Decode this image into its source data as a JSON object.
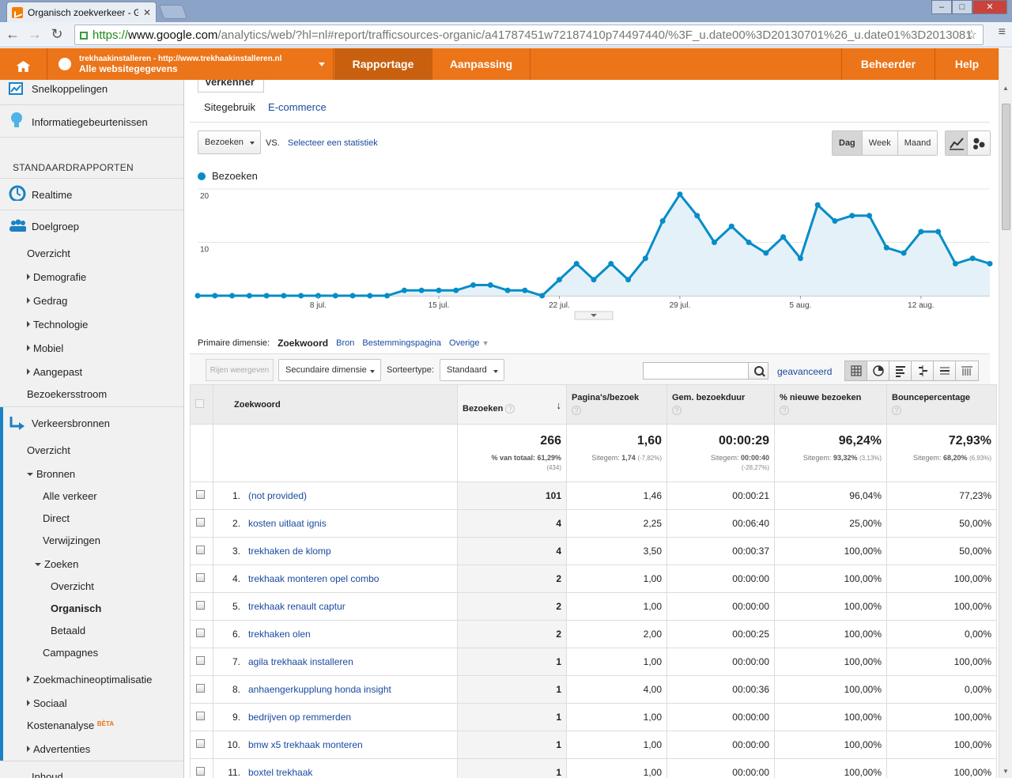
{
  "browser": {
    "tab_title": "Organisch zoekverkeer - G",
    "url_https": "https://",
    "url_host": "www.google.com",
    "url_path": "/analytics/web/?hl=nl#report/trafficsources-organic/a41787451w72187410p74497440/%3F_u.date00%3D20130701%26_u.date01%3D2013081"
  },
  "header": {
    "account_url": "trekhaakinstalleren - http://www.trekhaakinstalleren.nl",
    "account_view": "Alle websitegegevens",
    "tabs": [
      "Rapportage",
      "Aanpassing"
    ],
    "right_tabs": [
      "Beheerder",
      "Help"
    ]
  },
  "sidebar": {
    "snelkoppelingen": "Snelkoppelingen",
    "informatie": "Informatiegebeurtenissen",
    "standaard": "STANDAARDRAPPORTEN",
    "realtime": "Realtime",
    "doelgroep": "Doelgroep",
    "doelgroep_items": [
      "Overzicht",
      "Demografie",
      "Gedrag",
      "Technologie",
      "Mobiel",
      "Aangepast"
    ],
    "bezoekersstroom": "Bezoekersstroom",
    "verkeersbronnen": "Verkeersbronnen",
    "vb_overzicht": "Overzicht",
    "bronnen": "Bronnen",
    "bronnen_items": [
      "Alle verkeer",
      "Direct",
      "Verwijzingen"
    ],
    "zoeken": "Zoeken",
    "zoeken_items": [
      "Overzicht",
      "Organisch",
      "Betaald"
    ],
    "campagnes": "Campagnes",
    "seo": "Zoekmachineoptimalisatie",
    "sociaal": "Sociaal",
    "kosten": "Kostenanalyse",
    "beta": "BÈTA",
    "advertenties": "Advertenties",
    "inhoud": "Inhoud"
  },
  "explorer": {
    "tab": "Verkenner",
    "subtabs": [
      "Sitegebruik",
      "E-commerce"
    ],
    "metric": "Bezoeken",
    "vs": "VS.",
    "select_metric": "Selecteer een statistiek",
    "periods": [
      "Dag",
      "Week",
      "Maand"
    ],
    "active_period": "Dag"
  },
  "chart_data": {
    "type": "area",
    "series": [
      {
        "name": "Bezoeken",
        "values": [
          0,
          0,
          0,
          0,
          0,
          0,
          0,
          0,
          0,
          0,
          0,
          0,
          1,
          1,
          1,
          1,
          2,
          2,
          1,
          1,
          0,
          3,
          6,
          3,
          6,
          3,
          7,
          14,
          19,
          15,
          10,
          13,
          10,
          8,
          11,
          7,
          17,
          14,
          15,
          15,
          9,
          8,
          12,
          12,
          6,
          7,
          6
        ]
      }
    ],
    "x_tick_labels": [
      "8 jul.",
      "15 jul.",
      "22 jul.",
      "29 jul.",
      "5 aug.",
      "12 aug."
    ],
    "y_tick_labels": [
      "10",
      "20"
    ],
    "ylim": [
      0,
      20
    ],
    "color": "#058dc7",
    "fill": "#e5f1f8",
    "legend_position": "top-left",
    "grid": true
  },
  "dimensions": {
    "label": "Primaire dimensie:",
    "current": "Zoekwoord",
    "others": [
      "Bron",
      "Bestemmingspagina",
      "Overige"
    ]
  },
  "table_toolbar": {
    "rows_button": "Rijen weergeven",
    "secondary": "Secundaire dimensie",
    "sort_label": "Sorteertype:",
    "sort_value": "Standaard",
    "advanced": "geavanceerd"
  },
  "table": {
    "headers": [
      "Zoekwoord",
      "Bezoeken",
      "Pagina's/bezoek",
      "Gem. bezoekduur",
      "% nieuwe bezoeken",
      "Bouncepercentage"
    ],
    "totals": {
      "visits": "266",
      "visits_sub1": "% van totaal: 61,29%",
      "visits_sub2": "(434)",
      "pages": "1,60",
      "pages_sub_label": "Sitegem:",
      "pages_sub_val": "1,74",
      "pages_sub_pct": "(-7,82%)",
      "duration": "00:00:29",
      "duration_sub_label": "Sitegem:",
      "duration_sub_val": "00:00:40",
      "duration_sub_pct": "(-28,27%)",
      "new": "96,24%",
      "new_sub_label": "Sitegem:",
      "new_sub_val": "93,32%",
      "new_sub_pct": "(3,13%)",
      "bounce": "72,93%",
      "bounce_sub_label": "Sitegem:",
      "bounce_sub_val": "68,20%",
      "bounce_sub_pct": "(6,93%)"
    },
    "rows": [
      {
        "rank": "1.",
        "kw": "(not provided)",
        "visits": "101",
        "pages": "1,46",
        "dur": "00:00:21",
        "new": "96,04%",
        "bounce": "77,23%"
      },
      {
        "rank": "2.",
        "kw": "kosten uitlaat ignis",
        "visits": "4",
        "pages": "2,25",
        "dur": "00:06:40",
        "new": "25,00%",
        "bounce": "50,00%"
      },
      {
        "rank": "3.",
        "kw": "trekhaken de klomp",
        "visits": "4",
        "pages": "3,50",
        "dur": "00:00:37",
        "new": "100,00%",
        "bounce": "50,00%"
      },
      {
        "rank": "4.",
        "kw": "trekhaak monteren opel combo",
        "visits": "2",
        "pages": "1,00",
        "dur": "00:00:00",
        "new": "100,00%",
        "bounce": "100,00%"
      },
      {
        "rank": "5.",
        "kw": "trekhaak renault captur",
        "visits": "2",
        "pages": "1,00",
        "dur": "00:00:00",
        "new": "100,00%",
        "bounce": "100,00%"
      },
      {
        "rank": "6.",
        "kw": "trekhaken olen",
        "visits": "2",
        "pages": "2,00",
        "dur": "00:00:25",
        "new": "100,00%",
        "bounce": "0,00%"
      },
      {
        "rank": "7.",
        "kw": "agila trekhaak installeren",
        "visits": "1",
        "pages": "1,00",
        "dur": "00:00:00",
        "new": "100,00%",
        "bounce": "100,00%"
      },
      {
        "rank": "8.",
        "kw": "anhaengerkupplung honda insight",
        "visits": "1",
        "pages": "4,00",
        "dur": "00:00:36",
        "new": "100,00%",
        "bounce": "0,00%"
      },
      {
        "rank": "9.",
        "kw": "bedrijven op remmerden",
        "visits": "1",
        "pages": "1,00",
        "dur": "00:00:00",
        "new": "100,00%",
        "bounce": "100,00%"
      },
      {
        "rank": "10.",
        "kw": "bmw x5 trekhaak monteren",
        "visits": "1",
        "pages": "1,00",
        "dur": "00:00:00",
        "new": "100,00%",
        "bounce": "100,00%"
      },
      {
        "rank": "11.",
        "kw": "boxtel trekhaak",
        "visits": "1",
        "pages": "1,00",
        "dur": "00:00:00",
        "new": "100,00%",
        "bounce": "100,00%"
      }
    ]
  }
}
